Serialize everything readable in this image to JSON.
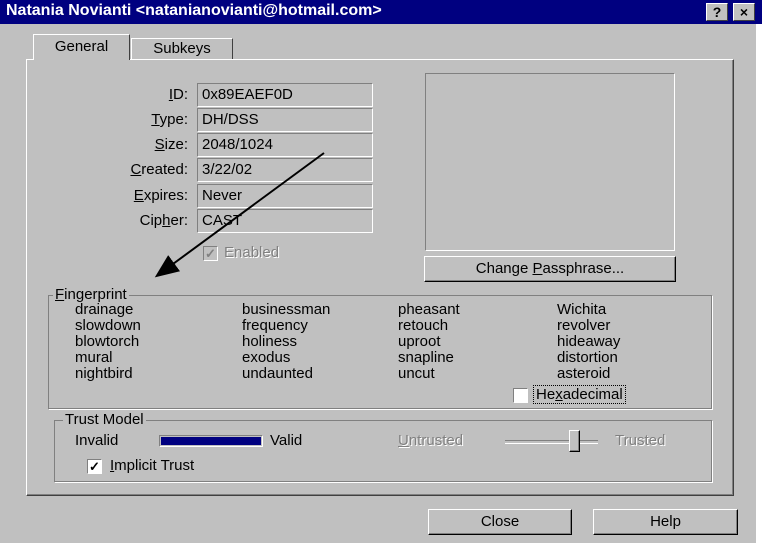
{
  "window": {
    "title": "Natania Novianti <natanianovianti@hotmail.com>"
  },
  "title_buttons": {
    "help": "?",
    "close": "×"
  },
  "tabs": [
    {
      "label": "General",
      "active": true
    },
    {
      "label": "Subkeys",
      "active": false
    }
  ],
  "properties": {
    "id": {
      "label": "ID:",
      "value": "0x89EAEF0D"
    },
    "type": {
      "label": "Type:",
      "value": "DH/DSS"
    },
    "size": {
      "label": "Size:",
      "value": "2048/1024"
    },
    "created": {
      "label": "Created:",
      "value": "3/22/02"
    },
    "expires": {
      "label": "Expires:",
      "value": "Never"
    },
    "cipher": {
      "label": "Cipher:",
      "value": "CAST"
    }
  },
  "enabled": {
    "label": "Enabled",
    "checked": true
  },
  "change_passphrase_button": "Change Passphrase...",
  "fingerprint": {
    "legend": "Fingerprint",
    "columns": [
      [
        "drainage",
        "slowdown",
        "blowtorch",
        "mural",
        "nightbird"
      ],
      [
        "businessman",
        "frequency",
        "holiness",
        "exodus",
        "undaunted"
      ],
      [
        "pheasant",
        "retouch",
        "uproot",
        "snapline",
        "uncut"
      ],
      [
        "Wichita",
        "revolver",
        "hideaway",
        "distortion",
        "asteroid"
      ]
    ],
    "hexadecimal": {
      "label": "Hexadecimal",
      "checked": false
    }
  },
  "trust_model": {
    "legend": "Trust Model",
    "invalid_label": "Invalid",
    "valid_label": "Valid",
    "validity_level": 1.0,
    "untrusted_label": "Untrusted",
    "trusted_label": "Trusted",
    "trust_level": 0.75,
    "implicit_trust": {
      "label": "Implicit Trust",
      "checked": true
    }
  },
  "buttons": {
    "close": "Close",
    "help": "Help"
  },
  "colors": {
    "titlebar": "#000080",
    "dialog": "#c0c0c0",
    "validity_bar": "#000080",
    "annotation_arrow": "#000000"
  }
}
